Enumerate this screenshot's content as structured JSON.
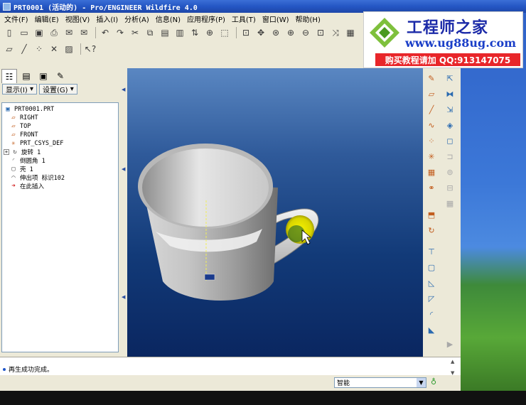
{
  "window": {
    "title": "PRT0001 (活动的) - Pro/ENGINEER Wildfire 4.0"
  },
  "menu": [
    "文件(F)",
    "编辑(E)",
    "视图(V)",
    "插入(I)",
    "分析(A)",
    "信息(N)",
    "应用程序(P)",
    "工具(T)",
    "窗口(W)",
    "帮助(H)"
  ],
  "logo": {
    "title": "工程师之家",
    "url": "www.ug88ug.com",
    "contact": "购买教程请加 QQ:913147075"
  },
  "panel": {
    "show_label": "显示(I)",
    "settings_label": "设置(G)"
  },
  "tree": [
    {
      "label": "PRT0001.PRT",
      "icon": "part-icon"
    },
    {
      "label": "RIGHT",
      "icon": "datum-plane-icon"
    },
    {
      "label": "TOP",
      "icon": "datum-plane-icon"
    },
    {
      "label": "FRONT",
      "icon": "datum-plane-icon"
    },
    {
      "label": "PRT_CSYS_DEF",
      "icon": "csys-icon"
    },
    {
      "label": "旋转 1",
      "icon": "revolve-icon"
    },
    {
      "label": "倒圆角 1",
      "icon": "round-icon"
    },
    {
      "label": "壳 1",
      "icon": "shell-icon"
    },
    {
      "label": "伸出项 标识102",
      "icon": "protrusion-icon"
    },
    {
      "label": "在此插入",
      "icon": "insert-here-icon"
    }
  ],
  "message": "再生成功完成。",
  "status": {
    "filter_value": "智能"
  },
  "colors": {
    "graphics_top": "#5a87c2",
    "graphics_bottom": "#0a2660",
    "highlight": "#e8e400",
    "logo_red": "#e8262a"
  }
}
